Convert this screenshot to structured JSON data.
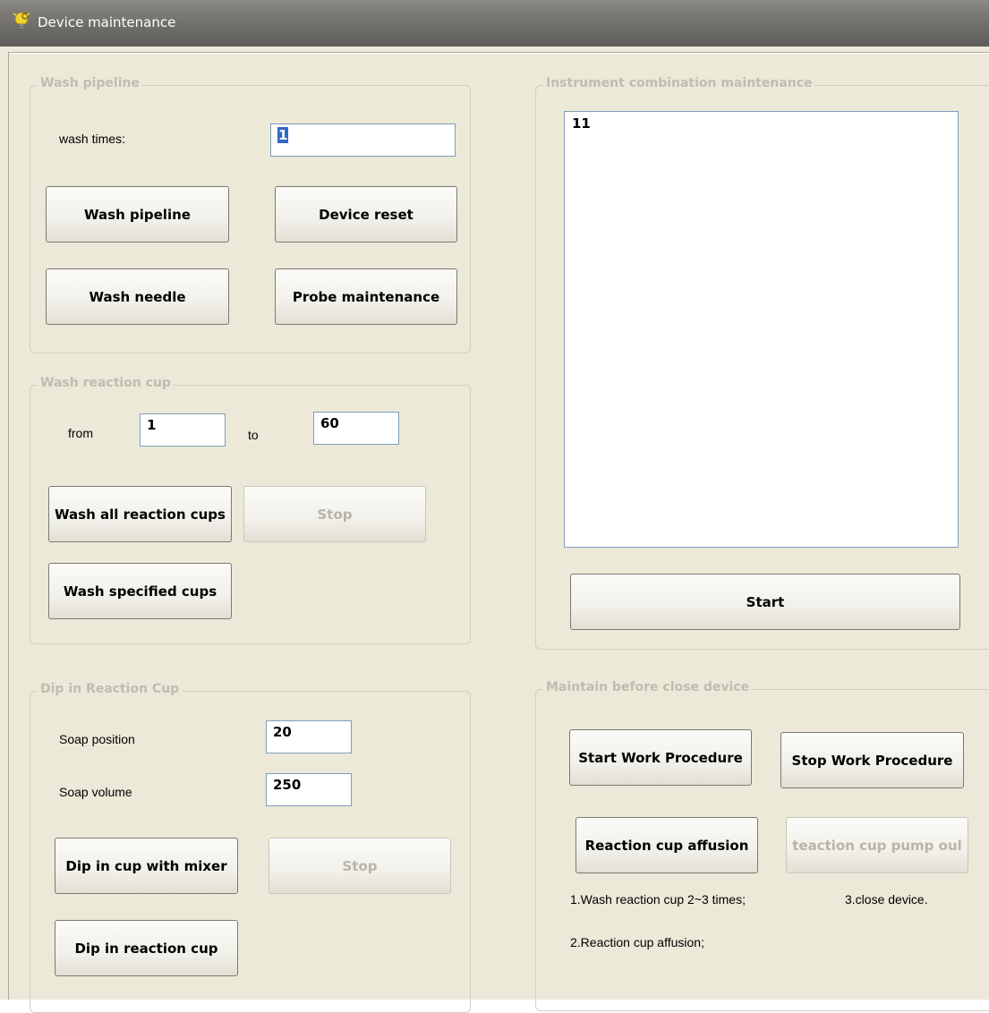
{
  "window": {
    "title": "Device maintenance",
    "icon": "lightbulb-gear-icon"
  },
  "wash_pipeline": {
    "title": "Wash pipeline",
    "wash_times_label": "wash times:",
    "wash_times_value": "1",
    "wash_pipeline_button": "Wash pipeline",
    "device_reset_button": "Device reset",
    "wash_needle_button": "Wash needle",
    "probe_maintenance_button": "Probe maintenance"
  },
  "wash_reaction_cup": {
    "title": "Wash reaction cup",
    "from_label": "from",
    "from_value": "1",
    "to_label": "to",
    "to_value": "60",
    "wash_all_button": "Wash all reaction cups",
    "stop_button": "Stop",
    "wash_specified_button": "Wash specified cups"
  },
  "dip_in_reaction_cup": {
    "title": "Dip in Reaction Cup",
    "soap_position_label": "Soap position",
    "soap_position_value": "20",
    "soap_volume_label": "Soap volume",
    "soap_volume_value": "250",
    "dip_with_mixer_button": "Dip in cup with mixer",
    "stop_button": "Stop",
    "dip_button": "Dip in reaction cup"
  },
  "instrument_combination": {
    "title": "Instrument combination maintenance",
    "list_items": [
      "11"
    ],
    "start_button": "Start"
  },
  "maintain_before_close": {
    "title": "Maintain before close device",
    "start_work_button": "Start Work Procedure",
    "stop_work_button": "Stop Work Procedure",
    "affusion_button": "Reaction cup affusion",
    "pump_out_button": "teaction cup pump oul",
    "note_1": "1.Wash reaction cup 2~3 times;",
    "note_2": "2.Reaction cup affusion;",
    "note_3": "3.close device."
  }
}
